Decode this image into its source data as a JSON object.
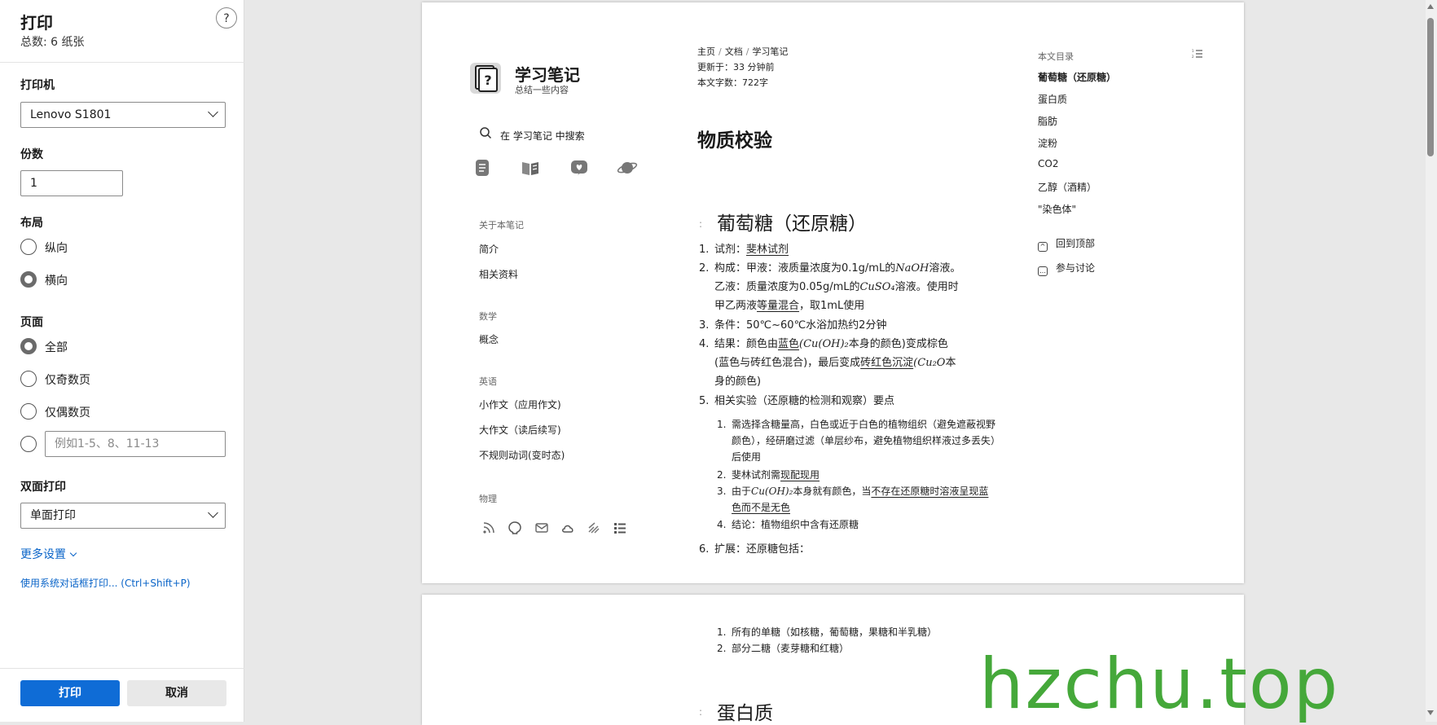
{
  "dialog": {
    "title": "打印",
    "total": "总数: 6 纸张",
    "help": "?",
    "printer_label": "打印机",
    "printer_value": "Lenovo S1801",
    "copies_label": "份数",
    "copies_value": "1",
    "layout_label": "布局",
    "layout_options": [
      "纵向",
      "横向"
    ],
    "pages_label": "页面",
    "pages_options": [
      "全部",
      "仅奇数页",
      "仅偶数页"
    ],
    "range_placeholder": "例如1-5、8、11-13",
    "duplex_label": "双面打印",
    "duplex_value": "单面打印",
    "more_settings": "更多设置",
    "system_dialog": "使用系统对话框打印... (Ctrl+Shift+P)",
    "print_button": "打印",
    "cancel_button": "取消"
  },
  "preview": {
    "site_title": "学习笔记",
    "site_subtitle": "总结一些内容",
    "search_text": "在 学习笔记 中搜索",
    "sidebar": {
      "about_head": "关于本笔记",
      "about_items": [
        "简介",
        "相关资料"
      ],
      "math_head": "数学",
      "math_items": [
        "概念"
      ],
      "english_head": "英语",
      "english_items": [
        "小作文（应用作文)",
        "大作文（读后续写)",
        "不规则动词(变时态)"
      ],
      "physics_head": "物理"
    },
    "breadcrumb": [
      "主页",
      "文档",
      "学习笔记"
    ],
    "updated": "更新于：33 分钟前",
    "word_count": "本文字数：722字",
    "doc_title": "物质校验",
    "section1_title": "葡萄糖（还原糖）",
    "section_mark": ":",
    "items": {
      "i1_num": "1.",
      "i1_pre": "试剂：",
      "i1_u": "斐林试剂",
      "i2_num": "2.",
      "i2_a": "构成：甲液：液质量浓度为0.1g/mL的",
      "i2_m1": "NaOH",
      "i2_b": "溶液。",
      "i2_c": "乙液：质量浓度为0.05g/mL的",
      "i2_m2": "CuSO₄",
      "i2_d": "溶液。使用时",
      "i2_e": "甲乙两液",
      "i2_u": "等量混合",
      "i2_f": "，取1mL使用",
      "i3_num": "3.",
      "i3_text": "条件：50℃~60℃水浴加热约2分钟",
      "i4_num": "4.",
      "i4_a": "结果：颜色由",
      "i4_u1": "蓝色",
      "i4_m1": "(Cu(OH)₂",
      "i4_b": "本身的颜色)变成棕色",
      "i4_c": "(蓝色与砖红色混合)，最后变成",
      "i4_u2": "砖红色沉淀",
      "i4_m2": "(Cu₂O",
      "i4_d": "本",
      "i4_e": "身的颜色)",
      "i5_num": "5.",
      "i5_text": "相关实验（还原糖的检测和观察）要点",
      "s1_num": "1.",
      "s1_text": "需选择含糖量高，白色或近于白色的植物组织（避免遮蔽视野颜色），经研磨过滤（单层纱布，避免植物组织样液过多丢失）后使用",
      "s2_num": "2.",
      "s2_a": "斐林试剂需",
      "s2_u": "现配现用",
      "s3_num": "3.",
      "s3_a": "由于",
      "s3_m": "Cu(OH)₂",
      "s3_b": "本身就有颜色，当",
      "s3_u": "不存在还原糖时溶液呈现蓝色而不是无色",
      "s4_num": "4.",
      "s4_text": "结论：植物组织中含有还原糖",
      "i6_num": "6.",
      "i6_text": "扩展：还原糖包括："
    },
    "page2": {
      "p1_num": "1.",
      "p1_text": "所有的单糖（如核糖，葡萄糖，果糖和半乳糖）",
      "p2_num": "2.",
      "p2_text": "部分二糖（麦芽糖和红糖）",
      "section2_title": "蛋白质"
    },
    "toc": {
      "head": "本文目录",
      "items": [
        "葡萄糖（还原糖）",
        "蛋白质",
        "脂肪",
        "淀粉",
        "CO2",
        "乙醇（酒精）",
        "\"染色体\""
      ],
      "back_top": "回到顶部",
      "discuss": "参与讨论"
    }
  },
  "watermark": "hzchu.top",
  "icons": [
    "help-icon",
    "chevron-down-icon",
    "search-icon",
    "notes-icon",
    "book-icon",
    "heart-icon",
    "planet-icon",
    "rss-icon",
    "github-icon",
    "mail-icon",
    "cloud-icon",
    "toc-icon",
    "back-top-icon",
    "comment-icon"
  ]
}
